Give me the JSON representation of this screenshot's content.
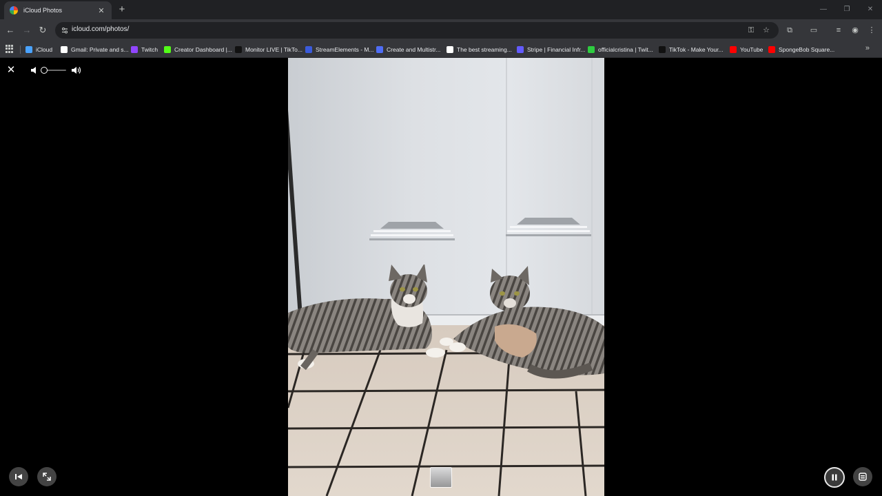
{
  "browser": {
    "tab": {
      "title": "iCloud Photos"
    },
    "new_tab_symbol": "+",
    "url": "icloud.com/photos/",
    "window_controls": [
      "minimize-icon",
      "restore-icon",
      "close-icon"
    ]
  },
  "bookmarks": [
    {
      "label": "iCloud",
      "icon": "icloud-icon",
      "color": "#4aa3ff"
    },
    {
      "label": "Gmail: Private and s...",
      "icon": "google-icon",
      "color": "#ffffff"
    },
    {
      "label": "Twitch",
      "icon": "twitch-icon",
      "color": "#9146ff"
    },
    {
      "label": "Creator Dashboard |...",
      "icon": "kick-icon",
      "color": "#53fc18"
    },
    {
      "label": "Monitor LIVE | TikTo...",
      "icon": "tiktok-icon",
      "color": "#111111"
    },
    {
      "label": "StreamElements - M...",
      "icon": "streamelements-icon",
      "color": "#3b5bdb"
    },
    {
      "label": "Create and Multistr...",
      "icon": "restream-icon",
      "color": "#4f6df5"
    },
    {
      "label": "The best streaming...",
      "icon": "diamond-icon",
      "color": "#ffffff"
    },
    {
      "label": "Stripe | Financial Infr...",
      "icon": "stripe-icon",
      "color": "#635bff"
    },
    {
      "label": "officialcristina | Twit...",
      "icon": "twitch-green-icon",
      "color": "#2ecc40"
    },
    {
      "label": "TikTok - Make Your...",
      "icon": "tiktok-icon",
      "color": "#111111"
    },
    {
      "label": "YouTube",
      "icon": "youtube-icon",
      "color": "#ff0000"
    },
    {
      "label": "SpongeBob Square...",
      "icon": "youtube-icon",
      "color": "#ff0000"
    }
  ],
  "viewer": {
    "close_symbol": "✕",
    "volume_level": 0.05,
    "controls": [
      "previous-icon",
      "fullscreen-icon",
      "pause-icon",
      "info-panel-icon"
    ]
  }
}
